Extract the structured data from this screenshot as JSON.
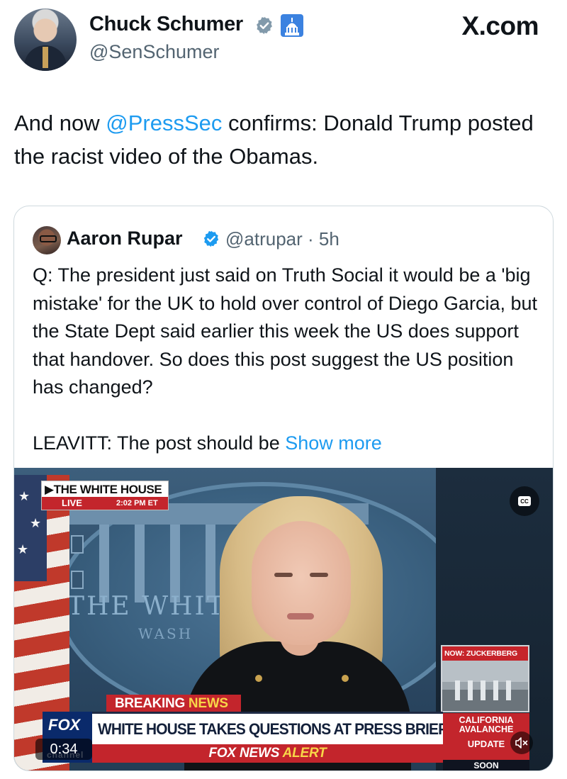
{
  "author": {
    "name": "Chuck Schumer",
    "handle": "@SenSchumer",
    "avatar_icon": "profile-photo"
  },
  "site": {
    "label": "X.com"
  },
  "tweet": {
    "prefix": "And now ",
    "mention": "@PressSec",
    "suffix": " confirms: Donald Trump posted the racist video of the Obamas."
  },
  "quote": {
    "name": "Aaron Rupar",
    "handle_time": "@atrupar · 5h",
    "paragraph1": "Q: The president just said on Truth Social it would be a 'big mistake' for the UK to hold over control of Diego Garcia, but the State Dept said earlier this week the US does support that handover. So does this post suggest the US position has changed?",
    "paragraph2_prefix": "LEAVITT: The post should be ",
    "show_more": "Show more"
  },
  "video": {
    "overlay_title": "▶THE WHITE HOUSE",
    "live_label": "LIVE",
    "live_time": "2:02 PM ET",
    "wall_text": "THE WHIT",
    "wall_text2": "WASH",
    "cc_label": "CC",
    "inset_label": "NOW: ZUCKERBERG TESTIFIES",
    "breaking_prefix": "BREAKING ",
    "breaking_news": "NEWS",
    "headline": "WHITE HOUSE TAKES QUESTIONS AT PRESS BRIEFING",
    "alert_prefix": "FOX NEWS ",
    "alert_word": "ALERT",
    "fox_logo": "FOX",
    "fox_sub": "channel",
    "side_line1": "CALIFORNIA AVALANCHE",
    "side_line2": "UPDATE",
    "side_soon": "SOON",
    "timestamp": "0:34"
  },
  "colors": {
    "link": "#1d9bf0",
    "secondary_text": "#536471",
    "fox_red": "#c3252c",
    "fox_yellow": "#f8d648"
  }
}
